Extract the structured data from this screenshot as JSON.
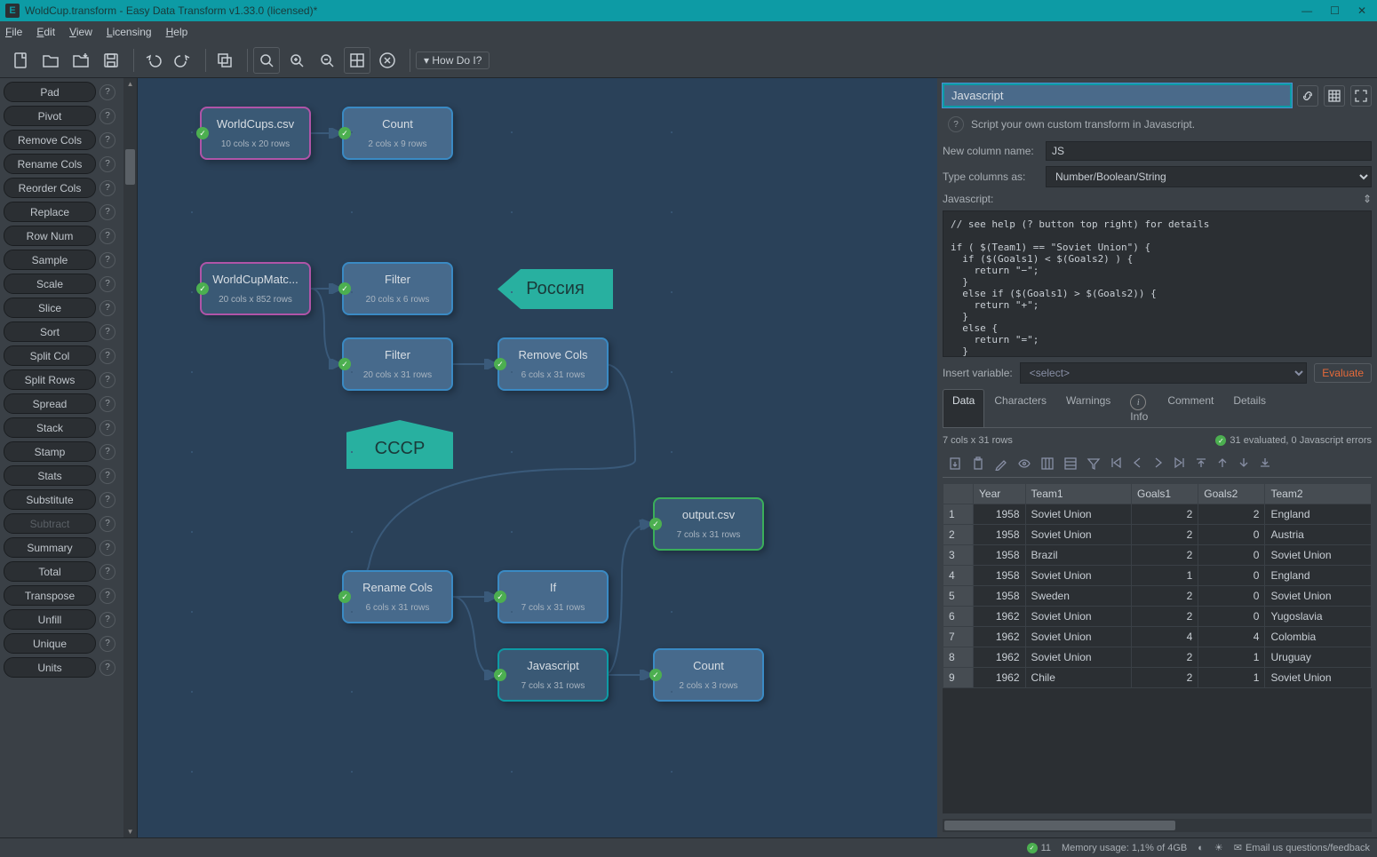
{
  "window": {
    "title": "WoldCup.transform - Easy Data Transform v1.33.0 (licensed)*"
  },
  "menubar": [
    "File",
    "Edit",
    "View",
    "Licensing",
    "Help"
  ],
  "toolbar_howdo": "How Do I?",
  "left_transforms": [
    {
      "label": "Pad",
      "disabled": false
    },
    {
      "label": "Pivot",
      "disabled": false
    },
    {
      "label": "Remove Cols",
      "disabled": false
    },
    {
      "label": "Rename Cols",
      "disabled": false
    },
    {
      "label": "Reorder Cols",
      "disabled": false
    },
    {
      "label": "Replace",
      "disabled": false
    },
    {
      "label": "Row Num",
      "disabled": false
    },
    {
      "label": "Sample",
      "disabled": false
    },
    {
      "label": "Scale",
      "disabled": false
    },
    {
      "label": "Slice",
      "disabled": false
    },
    {
      "label": "Sort",
      "disabled": false
    },
    {
      "label": "Split Col",
      "disabled": false
    },
    {
      "label": "Split Rows",
      "disabled": false
    },
    {
      "label": "Spread",
      "disabled": false
    },
    {
      "label": "Stack",
      "disabled": false
    },
    {
      "label": "Stamp",
      "disabled": false
    },
    {
      "label": "Stats",
      "disabled": false
    },
    {
      "label": "Substitute",
      "disabled": false
    },
    {
      "label": "Subtract",
      "disabled": true
    },
    {
      "label": "Summary",
      "disabled": false
    },
    {
      "label": "Total",
      "disabled": false
    },
    {
      "label": "Transpose",
      "disabled": false
    },
    {
      "label": "Unfill",
      "disabled": false
    },
    {
      "label": "Unique",
      "disabled": false
    },
    {
      "label": "Units",
      "disabled": false
    }
  ],
  "canvas": {
    "nodes": {
      "worldcups": {
        "title": "WorldCups.csv",
        "sub": "10 cols x 20 rows"
      },
      "count1": {
        "title": "Count",
        "sub": "2 cols x 9 rows"
      },
      "matches": {
        "title": "WorldCupMatc...",
        "sub": "20 cols x 852 rows"
      },
      "filter1": {
        "title": "Filter",
        "sub": "20 cols x 6 rows"
      },
      "filter2": {
        "title": "Filter",
        "sub": "20 cols x 31 rows"
      },
      "removecols": {
        "title": "Remove Cols",
        "sub": "6 cols x 31 rows"
      },
      "renamecols": {
        "title": "Rename Cols",
        "sub": "6 cols x 31 rows"
      },
      "if": {
        "title": "If",
        "sub": "7 cols x 31 rows"
      },
      "javascript": {
        "title": "Javascript",
        "sub": "7 cols x 31 rows"
      },
      "output": {
        "title": "output.csv",
        "sub": "7 cols x 31 rows"
      },
      "count2": {
        "title": "Count",
        "sub": "2 cols x 3 rows"
      }
    },
    "notes": {
      "russia": "Россия",
      "cccp": "СССР"
    }
  },
  "right": {
    "title_value": "Javascript",
    "hint": "Script your own custom transform in Javascript.",
    "newcol_label": "New column name:",
    "newcol_value": "JS",
    "typecols_label": "Type columns as:",
    "typecols_value": "Number/Boolean/String",
    "js_label": "Javascript:",
    "js_code": "// see help (? button top right) for details\n\nif ( $(Team1) == \"Soviet Union\") {\n  if ($(Goals1) < $(Goals2) ) {\n    return \"−\";\n  }\n  else if ($(Goals1) > $(Goals2)) {\n    return \"+\";\n  }\n  else {\n    return \"=\";\n  }",
    "insert_label": "Insert variable:",
    "insert_value": "<select>",
    "evaluate": "Evaluate",
    "tabs": [
      "Data",
      "Characters",
      "Warnings",
      "Info",
      "Comment",
      "Details"
    ],
    "summary_left": "7 cols x 31 rows",
    "summary_right": "31 evaluated, 0 Javascript errors",
    "table_cols": [
      "",
      "Year",
      "Team1",
      "Goals1",
      "Goals2",
      "Team2"
    ],
    "table_rows": [
      {
        "n": "1",
        "Year": "1958",
        "Team1": "Soviet Union",
        "Goals1": "2",
        "Goals2": "2",
        "Team2": "England"
      },
      {
        "n": "2",
        "Year": "1958",
        "Team1": "Soviet Union",
        "Goals1": "2",
        "Goals2": "0",
        "Team2": "Austria"
      },
      {
        "n": "3",
        "Year": "1958",
        "Team1": "Brazil",
        "Goals1": "2",
        "Goals2": "0",
        "Team2": "Soviet Union"
      },
      {
        "n": "4",
        "Year": "1958",
        "Team1": "Soviet Union",
        "Goals1": "1",
        "Goals2": "0",
        "Team2": "England"
      },
      {
        "n": "5",
        "Year": "1958",
        "Team1": "Sweden",
        "Goals1": "2",
        "Goals2": "0",
        "Team2": "Soviet Union"
      },
      {
        "n": "6",
        "Year": "1962",
        "Team1": "Soviet Union",
        "Goals1": "2",
        "Goals2": "0",
        "Team2": "Yugoslavia"
      },
      {
        "n": "7",
        "Year": "1962",
        "Team1": "Soviet Union",
        "Goals1": "4",
        "Goals2": "4",
        "Team2": "Colombia"
      },
      {
        "n": "8",
        "Year": "1962",
        "Team1": "Soviet Union",
        "Goals1": "2",
        "Goals2": "1",
        "Team2": "Uruguay"
      },
      {
        "n": "9",
        "Year": "1962",
        "Team1": "Chile",
        "Goals1": "2",
        "Goals2": "1",
        "Team2": "Soviet Union"
      }
    ]
  },
  "statusbar": {
    "count": "11",
    "memory": "Memory usage: 1,1% of 4GB",
    "feedback": "Email us questions/feedback"
  }
}
